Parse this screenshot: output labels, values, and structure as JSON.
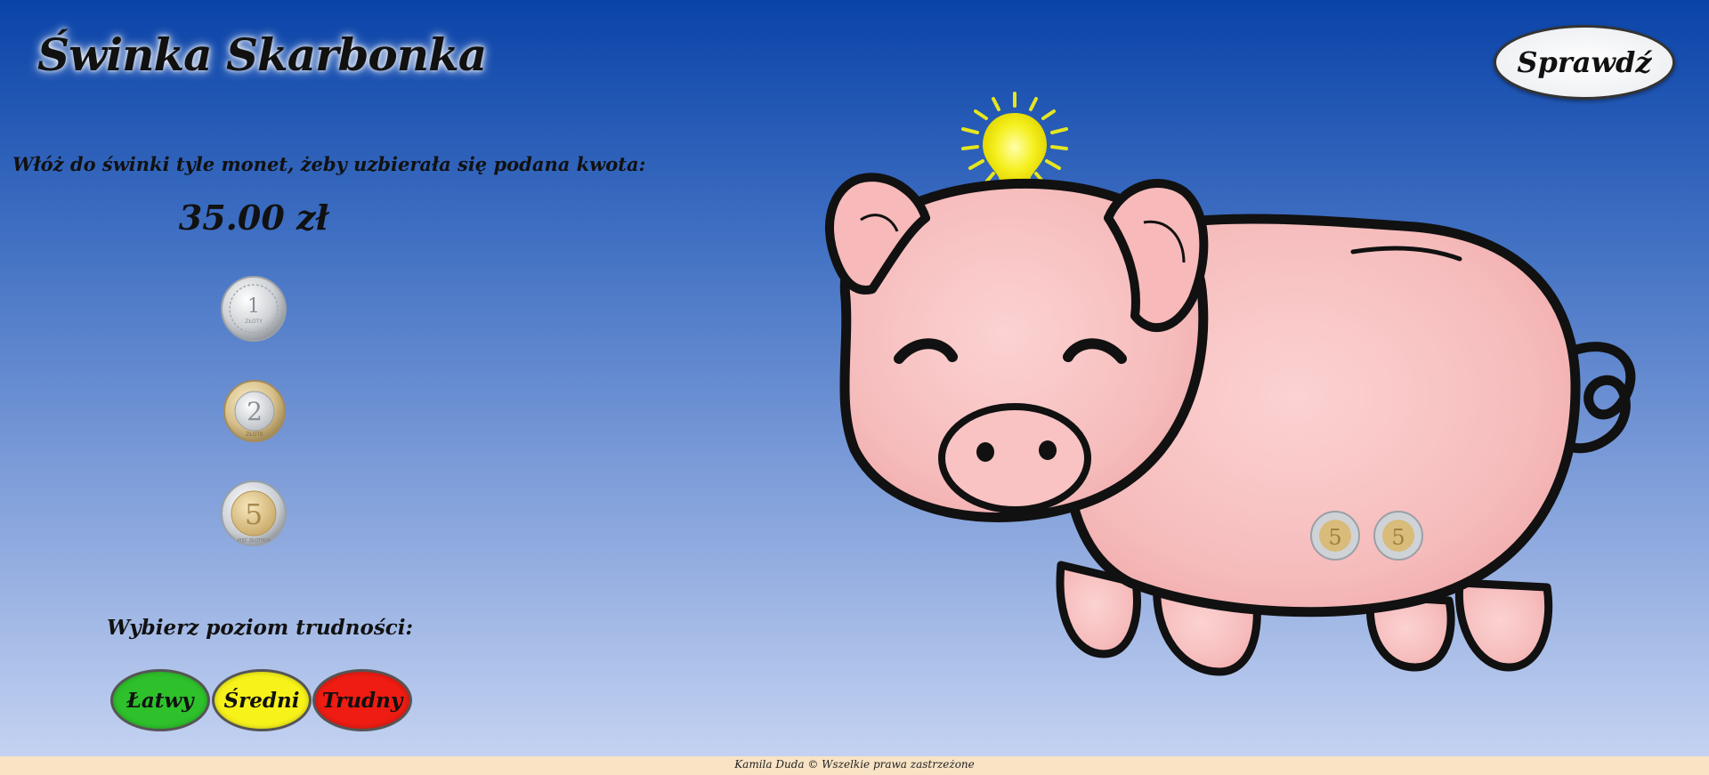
{
  "header": {
    "title": "Świnka Skarbonka",
    "check_label": "Sprawdź"
  },
  "task": {
    "instruction": "Włóż do świnki tyle monet, żeby uzbierała się podana kwota:",
    "amount": "35.00 zł"
  },
  "coins": [
    {
      "value": "1",
      "caption": "ZŁOTY",
      "icon": "coin-1-zloty-icon"
    },
    {
      "value": "2",
      "caption": "ZŁOTE",
      "icon": "coin-2-zlote-icon"
    },
    {
      "value": "5",
      "caption": "PIĘĆ ZŁOTYCH",
      "icon": "coin-5-zlotych-icon"
    }
  ],
  "levels": {
    "label": "Wybierz poziom trudności:",
    "easy": "Łatwy",
    "medium": "Średni",
    "hard": "Trudny",
    "colors": {
      "easy": "#2ec12b",
      "medium": "#f7f21a",
      "hard": "#ee1c12"
    }
  },
  "pig": {
    "coins_inside": [
      "5",
      "5"
    ],
    "hint_icon": "lightbulb-icon"
  },
  "footer": {
    "text": "Kamila Duda © Wszelkie prawa zastrzeżone"
  }
}
